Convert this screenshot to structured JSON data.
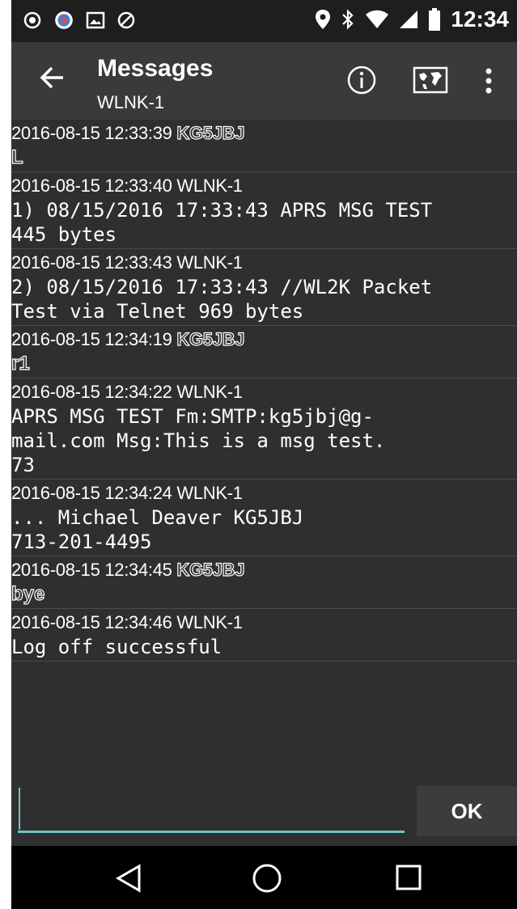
{
  "status_bar": {
    "time": "12:34",
    "left_icons": [
      "app-notification-icon",
      "app-notification-icon-2",
      "image-icon",
      "shield-icon"
    ],
    "right_icons": [
      "location-icon",
      "bluetooth-icon",
      "wifi-icon",
      "signal-icon",
      "battery-icon"
    ]
  },
  "toolbar": {
    "title": "Messages",
    "subtitle": "WLNK-1",
    "icons": [
      "back-arrow-icon",
      "info-icon",
      "map-icon",
      "more-vert-icon"
    ]
  },
  "messages": [
    {
      "timestamp": "2016-08-15 12:33:39",
      "sender": "KG5JBJ",
      "outgoing": true,
      "body": "L"
    },
    {
      "timestamp": "2016-08-15 12:33:40",
      "sender": "WLNK-1",
      "outgoing": false,
      "body": "1) 08/15/2016 17:33:43 APRS MSG TEST\n445 bytes"
    },
    {
      "timestamp": "2016-08-15 12:33:43",
      "sender": "WLNK-1",
      "outgoing": false,
      "body": "2) 08/15/2016 17:33:43 //WL2K Packet\nTest via Telnet 969 bytes"
    },
    {
      "timestamp": "2016-08-15 12:34:19",
      "sender": "KG5JBJ",
      "outgoing": true,
      "body": "r1"
    },
    {
      "timestamp": "2016-08-15 12:34:22",
      "sender": "WLNK-1",
      "outgoing": false,
      "body": "APRS MSG TEST Fm:SMTP:kg5jbj@g-\nmail.com Msg:This is a msg test.\n73"
    },
    {
      "timestamp": "2016-08-15 12:34:24",
      "sender": "WLNK-1",
      "outgoing": false,
      "body": "... Michael Deaver KG5JBJ\n713-201-4495"
    },
    {
      "timestamp": "2016-08-15 12:34:45",
      "sender": "KG5JBJ",
      "outgoing": true,
      "body": "bye"
    },
    {
      "timestamp": "2016-08-15 12:34:46",
      "sender": "WLNK-1",
      "outgoing": false,
      "body": "Log off successful"
    }
  ],
  "input": {
    "value": "",
    "placeholder": "",
    "ok_label": "OK"
  },
  "nav_bar": {
    "icons": [
      "nav-back-icon",
      "nav-home-icon",
      "nav-recent-apps-icon"
    ]
  },
  "colors": {
    "accent": "#6fc7c2",
    "background": "#2f2f2f",
    "toolbar": "#3a3a3a",
    "status_bar": "#1e1e1e"
  }
}
